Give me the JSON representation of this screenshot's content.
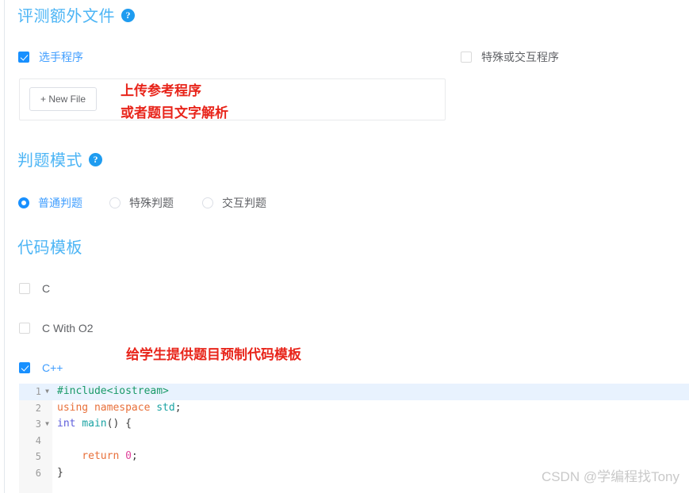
{
  "sections": {
    "extra_files": {
      "title": "评测额外文件",
      "help_icon": "question-mark-icon",
      "checkbox_contestant": {
        "label": "选手程序",
        "checked": true
      },
      "checkbox_special": {
        "label": "特殊或交互程序",
        "checked": false
      },
      "new_file_button": "+ New File",
      "annotation_line1": "上传参考程序",
      "annotation_line2": "或者题目文字解析"
    },
    "judge_mode": {
      "title": "判题模式",
      "help_icon": "question-mark-icon",
      "options": [
        {
          "label": "普通判题",
          "selected": true
        },
        {
          "label": "特殊判题",
          "selected": false
        },
        {
          "label": "交互判题",
          "selected": false
        }
      ]
    },
    "code_template": {
      "title": "代码模板",
      "annotation": "给学生提供题目预制代码模板",
      "languages": [
        {
          "label": "C",
          "checked": false
        },
        {
          "label": "C With O2",
          "checked": false
        },
        {
          "label": "C++",
          "checked": true
        }
      ],
      "editor": {
        "lines": [
          {
            "number": "1",
            "foldable": true,
            "active": true,
            "tokens": [
              {
                "t": "#include<iostream>",
                "c": "tok-pre"
              }
            ]
          },
          {
            "number": "2",
            "foldable": false,
            "active": false,
            "tokens": [
              {
                "t": "using namespace ",
                "c": "tok-kw"
              },
              {
                "t": "std",
                "c": "tok-fn"
              },
              {
                "t": ";",
                "c": "tok-plain"
              }
            ]
          },
          {
            "number": "3",
            "foldable": true,
            "active": false,
            "tokens": [
              {
                "t": "int ",
                "c": "tok-type"
              },
              {
                "t": "main",
                "c": "tok-fn"
              },
              {
                "t": "() {",
                "c": "tok-plain"
              }
            ]
          },
          {
            "number": "4",
            "foldable": false,
            "active": false,
            "tokens": []
          },
          {
            "number": "5",
            "foldable": false,
            "active": false,
            "tokens": [
              {
                "t": "    return ",
                "c": "tok-kw"
              },
              {
                "t": "0",
                "c": "tok-num"
              },
              {
                "t": ";",
                "c": "tok-plain"
              }
            ]
          },
          {
            "number": "6",
            "foldable": false,
            "active": false,
            "tokens": [
              {
                "t": "}",
                "c": "tok-plain"
              }
            ]
          }
        ]
      }
    }
  },
  "watermark": "CSDN @学编程找Tony",
  "colors": {
    "heading_blue": "#4db5f5",
    "accent_blue": "#1890ff",
    "annotation_red": "#e8251b",
    "watermark_gray": "#c9c9c9"
  }
}
